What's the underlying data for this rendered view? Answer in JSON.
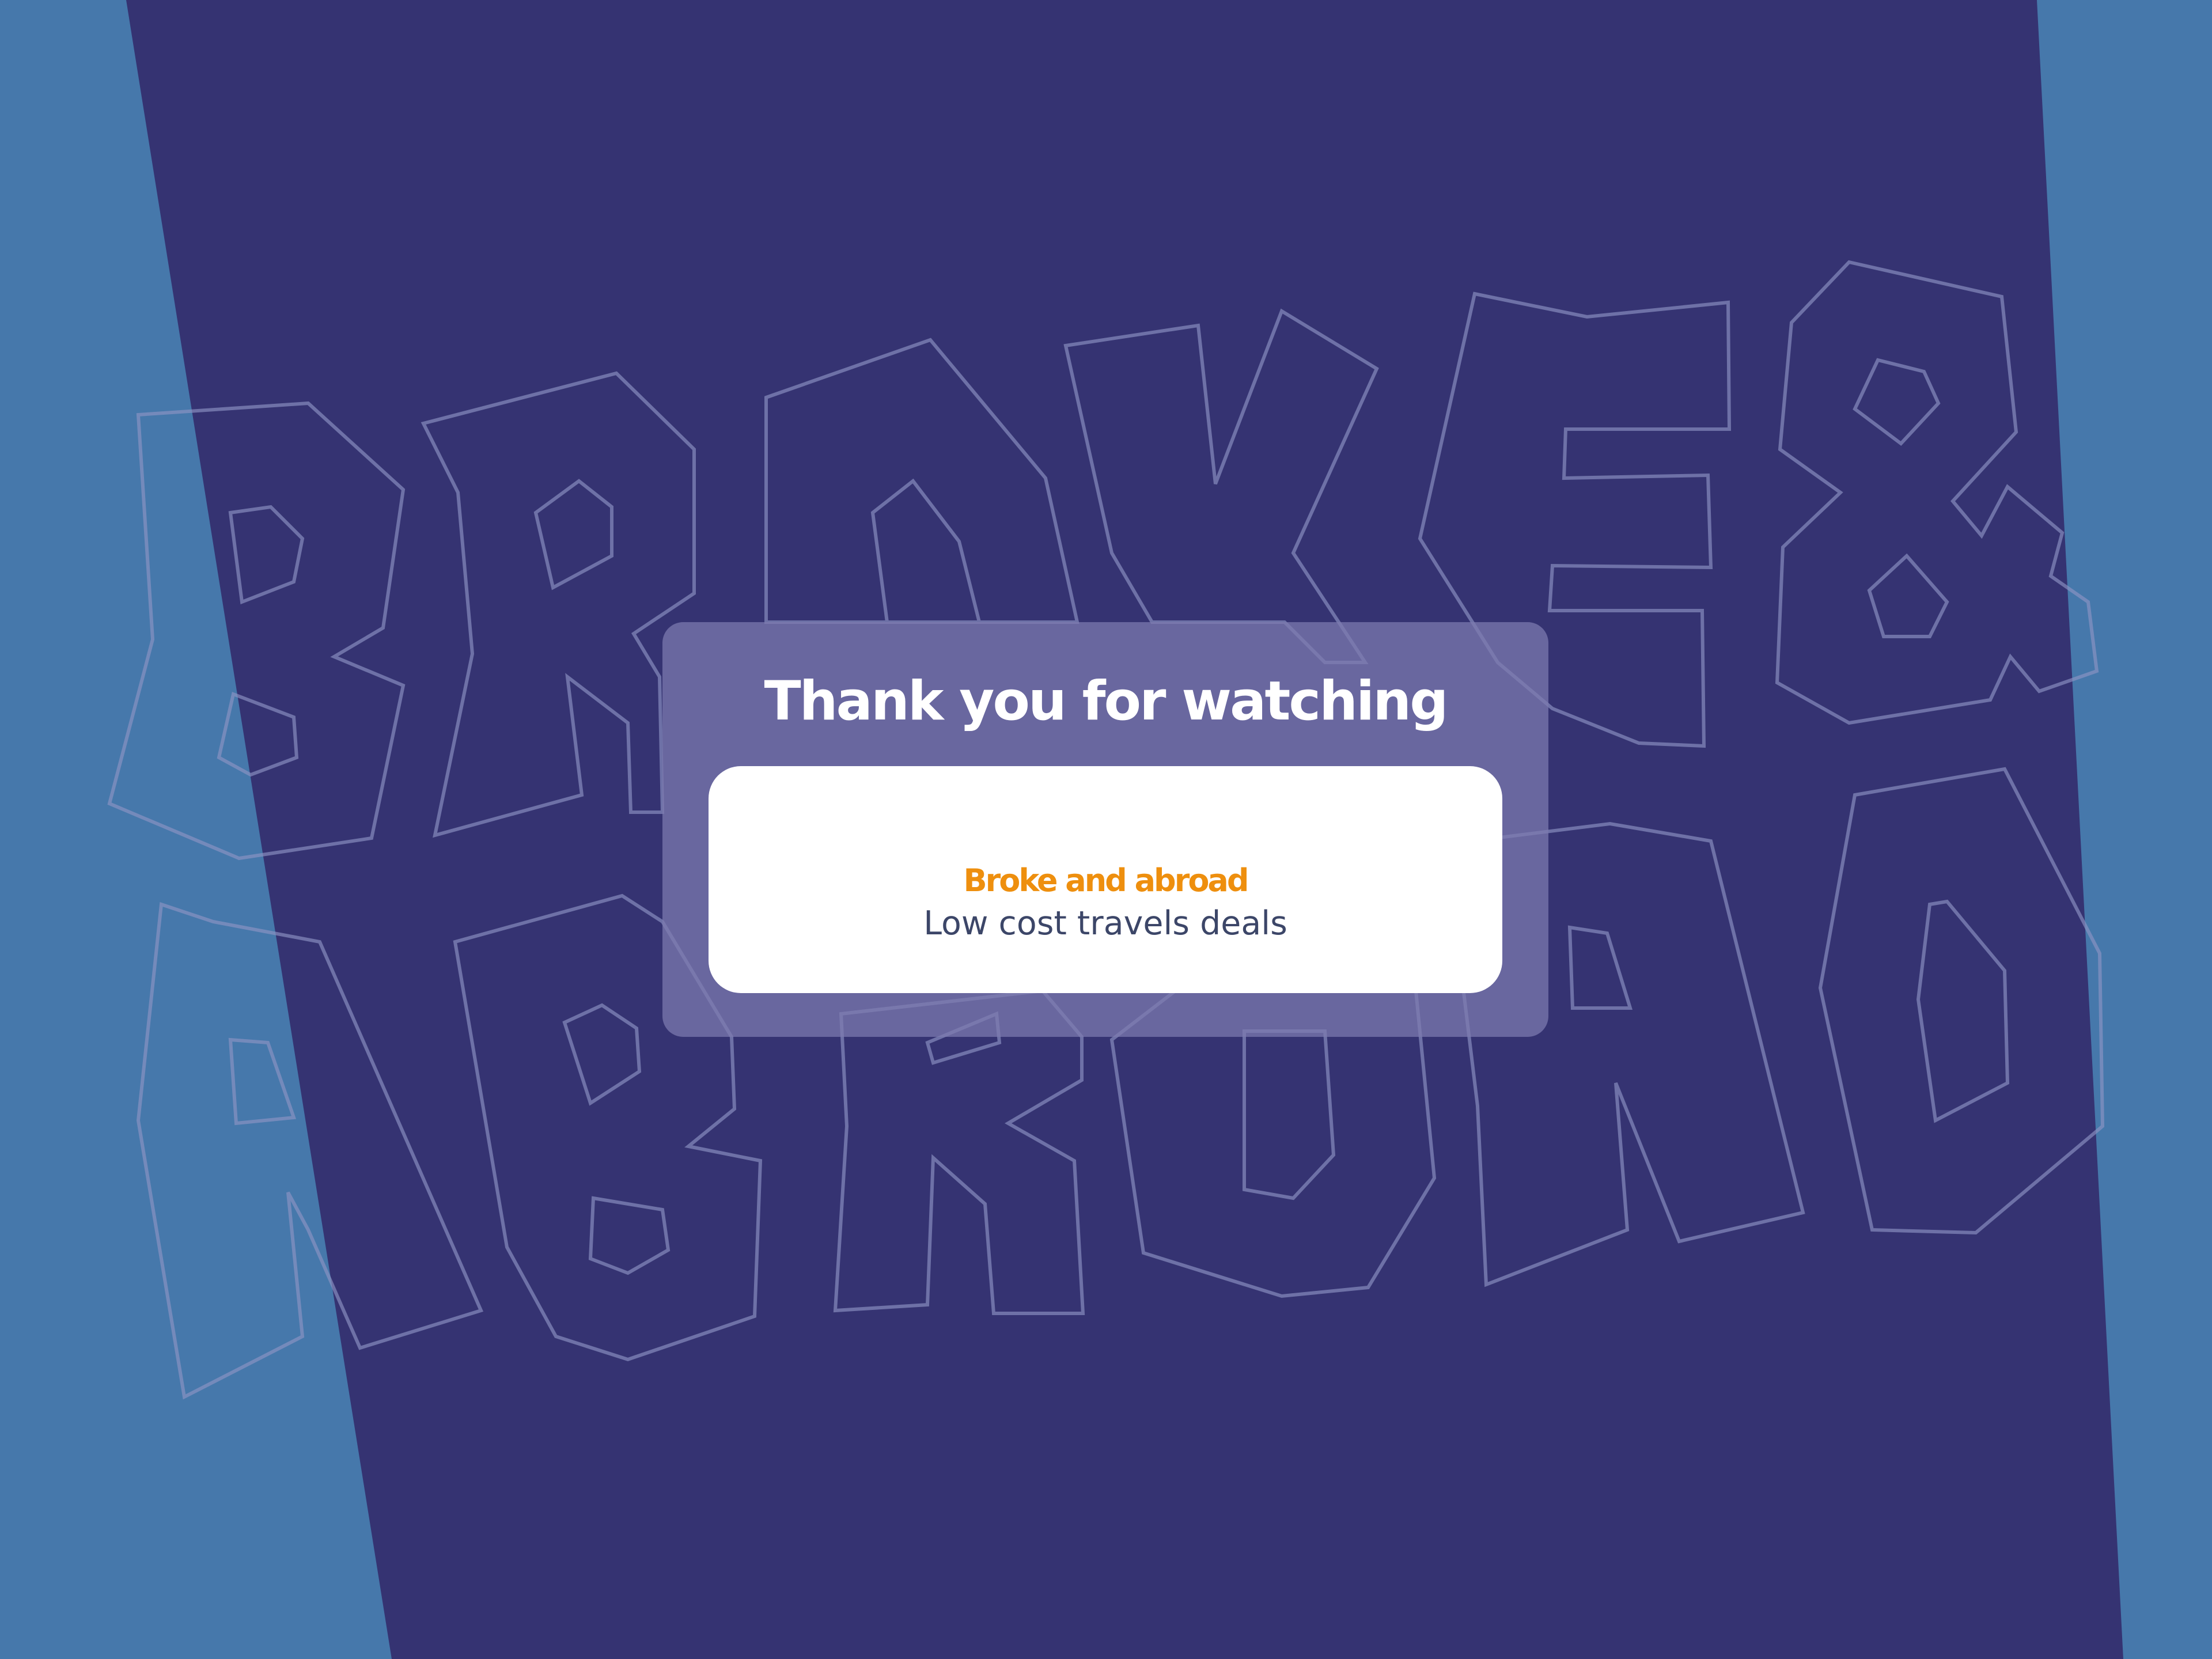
{
  "colors": {
    "side_background": "#4678ab",
    "center_band": "#353372",
    "letter_outline": "#8e94c3",
    "card_background": "#7e7bb0",
    "panel_background": "#ffffff",
    "brand_accent": "#ee8f0e",
    "tagline_text": "#3c4668",
    "title_text": "#ffffff"
  },
  "background": {
    "artwork": "broke-and-abroad-outline-lettering"
  },
  "end_card": {
    "title": "Thank you for watching",
    "brand_name": "Broke and abroad",
    "tagline": "Low cost travels deals"
  }
}
